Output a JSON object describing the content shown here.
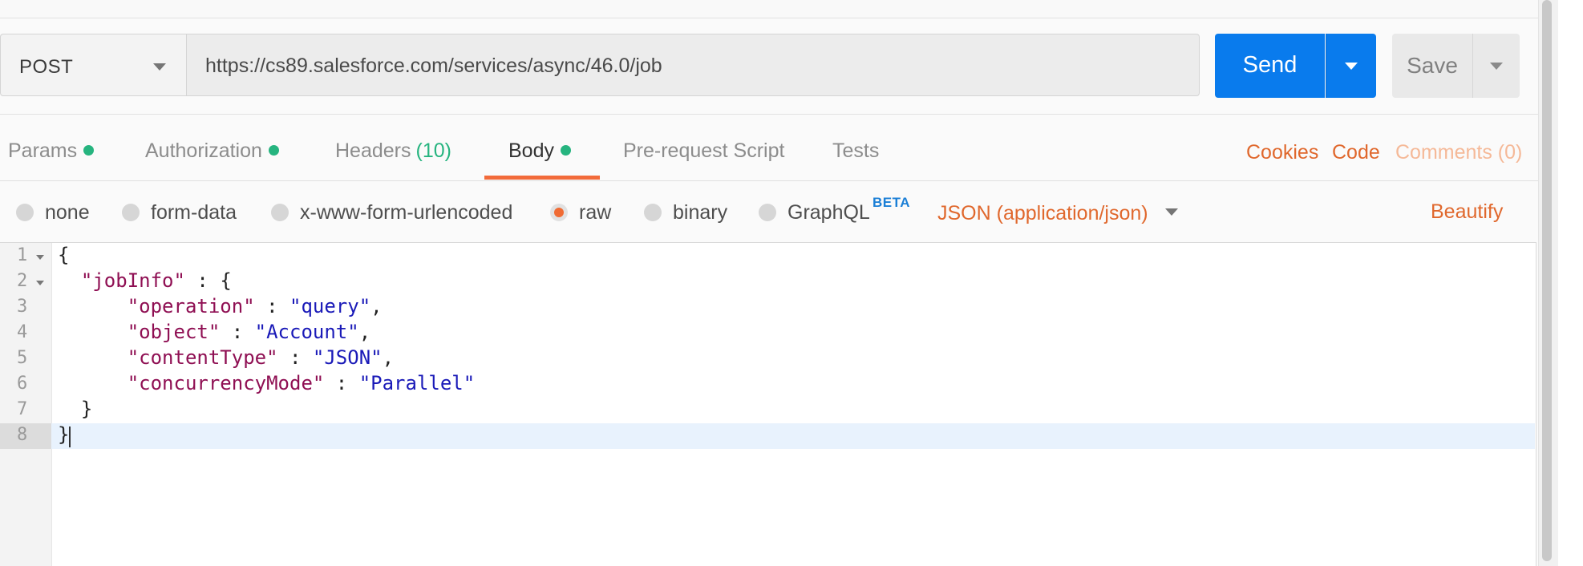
{
  "request": {
    "method": "POST",
    "url": "https://cs89.salesforce.com/services/async/46.0/job",
    "send_label": "Send",
    "save_label": "Save"
  },
  "tabs": [
    {
      "label": "Params",
      "dot": true
    },
    {
      "label": "Authorization",
      "dot": true
    },
    {
      "label": "Headers",
      "count": "(10)"
    },
    {
      "label": "Body",
      "dot": true,
      "active": true
    },
    {
      "label": "Pre-request Script"
    },
    {
      "label": "Tests"
    }
  ],
  "links": {
    "cookies": "Cookies",
    "code": "Code",
    "comments": "Comments (0)"
  },
  "body_options": [
    {
      "label": "none",
      "selected": false
    },
    {
      "label": "form-data",
      "selected": false
    },
    {
      "label": "x-www-form-urlencoded",
      "selected": false
    },
    {
      "label": "raw",
      "selected": true
    },
    {
      "label": "binary",
      "selected": false
    },
    {
      "label": "GraphQL",
      "selected": false
    }
  ],
  "beta_badge": "BETA",
  "content_type": "JSON (application/json)",
  "beautify_label": "Beautify",
  "editor": {
    "line_numbers": [
      "1",
      "2",
      "3",
      "4",
      "5",
      "6",
      "7",
      "8"
    ],
    "lines": [
      {
        "indent": "",
        "key": "",
        "sep": "",
        "value": "",
        "end": "{"
      },
      {
        "indent": "  ",
        "key": "\"jobInfo\"",
        "sep": " : ",
        "value": "",
        "end": "{"
      },
      {
        "indent": "      ",
        "key": "\"operation\"",
        "sep": " : ",
        "value": "\"query\"",
        "end": ","
      },
      {
        "indent": "      ",
        "key": "\"object\"",
        "sep": " : ",
        "value": "\"Account\"",
        "end": ","
      },
      {
        "indent": "      ",
        "key": "\"contentType\"",
        "sep": " : ",
        "value": "\"JSON\"",
        "end": ","
      },
      {
        "indent": "      ",
        "key": "\"concurrencyMode\"",
        "sep": " : ",
        "value": "\"Parallel\"",
        "end": ""
      },
      {
        "indent": "  ",
        "key": "",
        "sep": "",
        "value": "",
        "end": "}"
      },
      {
        "indent": "",
        "key": "",
        "sep": "",
        "value": "",
        "end": "}"
      }
    ],
    "active_line": "8"
  },
  "colors": {
    "accent_orange": "#e0682d",
    "send_blue": "#097bed",
    "status_green": "#26b47f",
    "json_key": "#8f0f53",
    "json_string": "#1a1ab8"
  }
}
